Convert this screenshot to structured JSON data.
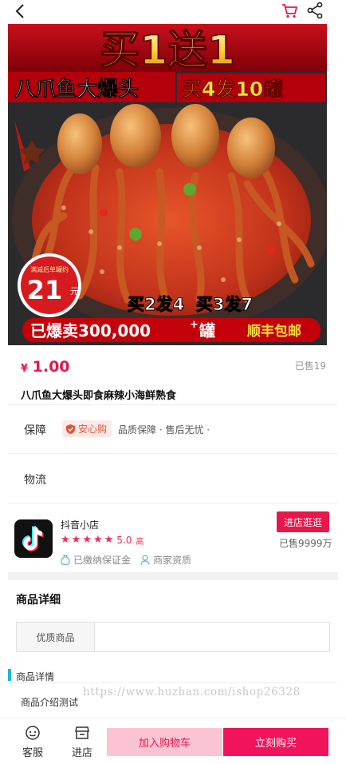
{
  "hero": {
    "headline": "买1送1",
    "product_name": "八爪鱼大爆头",
    "promo": "买4发10罐",
    "badge_small": "满减后单罐约",
    "badge_price": "21",
    "badge_unit": "元",
    "deal": "买2发4  买3发7",
    "sold_banner": "已爆卖300,000",
    "sold_plus": "+",
    "sold_suffix": "罐",
    "shipping": "顺丰包邮"
  },
  "product": {
    "currency": "¥",
    "price": "1.00",
    "sold": "已售19",
    "title": "八爪鱼大爆头即食麻辣小海鲜熟食"
  },
  "guarantee": {
    "label": "保障",
    "badge": "安心购",
    "text": "品质保障 · 售后无忧 ·"
  },
  "logistics": {
    "label": "物流"
  },
  "shop": {
    "name": "抖音小店",
    "rating": "5.0",
    "rating_tag": "高",
    "deposit": "已缴纳保证金",
    "qualification": "商家资质",
    "visit_label": "进店逛逛",
    "sold": "已售9999万"
  },
  "details": {
    "heading": "商品详细",
    "spec_key": "优质商品",
    "spec_value": "",
    "section_title": "商品详情",
    "intro": "商品介绍测试"
  },
  "watermark": "https://www.huzhan.com/ishop26328",
  "bottom": {
    "service_label": "客服",
    "store_label": "进店",
    "add_cart_label": "加入购物车",
    "buy_label": "立刻购买"
  },
  "colors": {
    "accent": "#e8174b",
    "buy": "#f1135b",
    "add_cart_bg": "#fbc4d3",
    "section_bar": "#1cb6d6"
  }
}
